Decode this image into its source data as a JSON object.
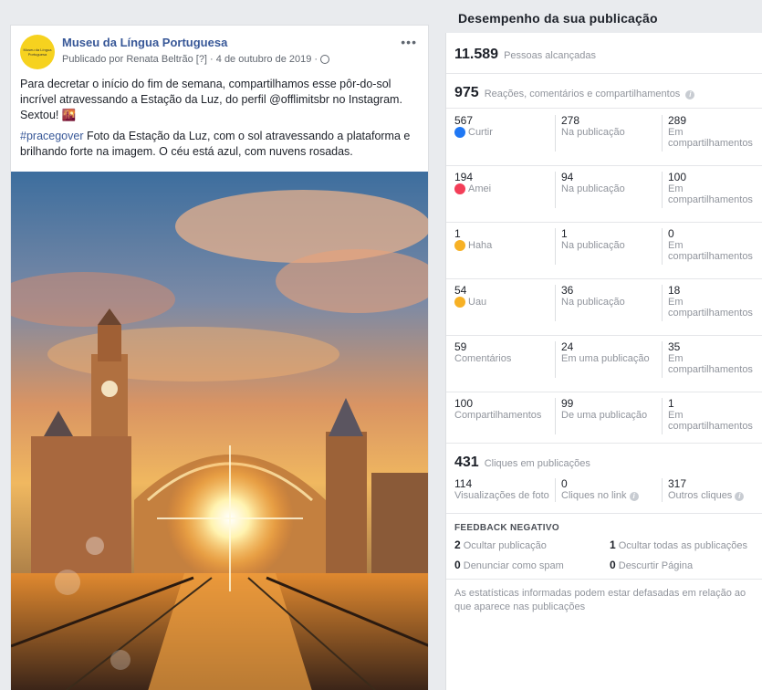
{
  "post": {
    "page_name": "Museu da Língua Portuguesa",
    "avatar_text": "Museu da Língua Portuguesa",
    "meta": "Publicado por Renata Beltrão [?] · 4 de outubro de 2019 ·",
    "more": "•••",
    "text1": "Para decretar o início do fim de semana, compartilhamos esse pôr-do-sol incrível atravessando a Estação da Luz, do perfil @offlimitsbr no Instagram. Sextou! 🌇",
    "hashtag": "#pracegover",
    "text2": " Foto da Estação da Luz, com o sol atravessando a plataforma e brilhando forte na imagem. O céu está azul, com nuvens rosadas."
  },
  "panel": {
    "title": "Desempenho da sua publicação",
    "reach_num": "11.589",
    "reach_label": "Pessoas alcançadas",
    "engagement_num": "975",
    "engagement_label": "Reações, comentários e compartilhamentos",
    "rows": [
      {
        "n1": "567",
        "l1": "Curtir",
        "n2": "278",
        "l2": "Na publicação",
        "n3": "289",
        "l3": "Em compartilhamentos"
      },
      {
        "n1": "194",
        "l1": "Amei",
        "n2": "94",
        "l2": "Na publicação",
        "n3": "100",
        "l3": "Em compartilhamentos"
      },
      {
        "n1": "1",
        "l1": "Haha",
        "n2": "1",
        "l2": "Na publicação",
        "n3": "0",
        "l3": "Em compartilhamentos"
      },
      {
        "n1": "54",
        "l1": "Uau",
        "n2": "36",
        "l2": "Na publicação",
        "n3": "18",
        "l3": "Em compartilhamentos"
      },
      {
        "n1": "59",
        "l1": "Comentários",
        "n2": "24",
        "l2": "Em uma publicação",
        "n3": "35",
        "l3": "Em compartilhamentos"
      },
      {
        "n1": "100",
        "l1": "Compartilhamentos",
        "n2": "99",
        "l2": "De uma publicação",
        "n3": "1",
        "l3": "Em compartilhamentos"
      }
    ],
    "clicks_num": "431",
    "clicks_label": "Cliques em publicações",
    "clicks": {
      "n1": "114",
      "l1": "Visualizações de foto",
      "n2": "0",
      "l2": "Cliques no link",
      "n3": "317",
      "l3": "Outros cliques"
    },
    "neg_title": "FEEDBACK NEGATIVO",
    "neg": [
      {
        "n": "2",
        "l": "Ocultar publicação"
      },
      {
        "n": "1",
        "l": "Ocultar todas as publicações"
      },
      {
        "n": "0",
        "l": "Denunciar como spam"
      },
      {
        "n": "0",
        "l": "Descurtir Página"
      }
    ],
    "footer": "As estatísticas informadas podem estar defasadas em relação ao que aparece nas publicações",
    "info_glyph": "i"
  },
  "colors": {
    "link": "#385898",
    "like": "#2078f4",
    "love": "#f33e58",
    "haha": "#f7b125"
  }
}
